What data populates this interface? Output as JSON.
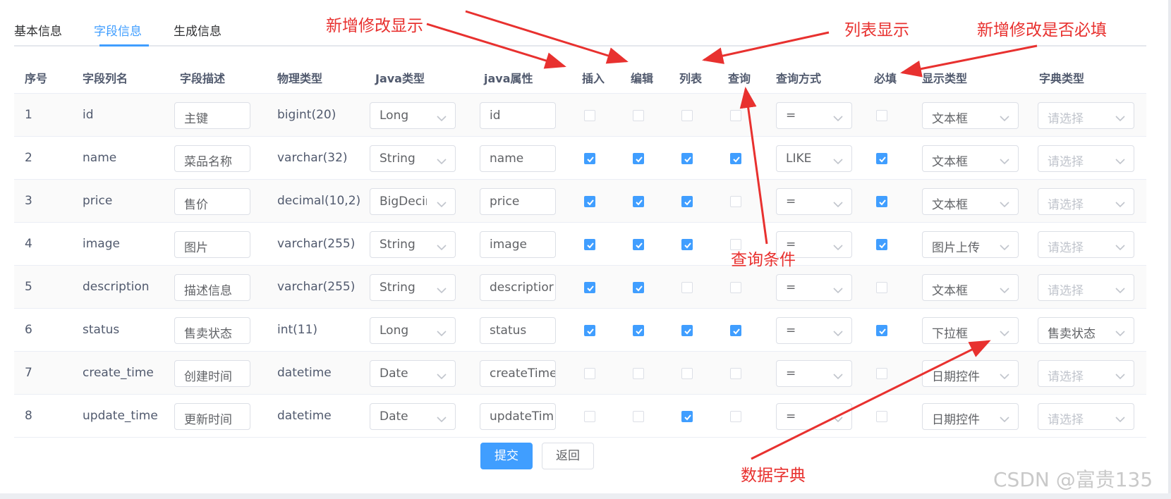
{
  "tabs": [
    {
      "label": "基本信息"
    },
    {
      "label": "字段信息"
    },
    {
      "label": "生成信息"
    }
  ],
  "table": {
    "headers": [
      "序号",
      "字段列名",
      "字段描述",
      "物理类型",
      "Java类型",
      "java属性",
      "插入",
      "编辑",
      "列表",
      "查询",
      "查询方式",
      "必填",
      "显示类型",
      "字典类型"
    ],
    "rows": [
      {
        "index": "1",
        "column": "id",
        "desc": "主键",
        "physical": "bigint(20)",
        "javaType": "Long",
        "javaField": "id",
        "insert": false,
        "edit": false,
        "list": false,
        "query": false,
        "queryType": "=",
        "required": false,
        "htmlType": "文本框",
        "dictType": "请选择",
        "dictPlaceholder": true
      },
      {
        "index": "2",
        "column": "name",
        "desc": "菜品名称",
        "physical": "varchar(32)",
        "javaType": "String",
        "javaField": "name",
        "insert": true,
        "edit": true,
        "list": true,
        "query": true,
        "queryType": "LIKE",
        "required": true,
        "htmlType": "文本框",
        "dictType": "请选择",
        "dictPlaceholder": true
      },
      {
        "index": "3",
        "column": "price",
        "desc": "售价",
        "physical": "decimal(10,2)",
        "javaType": "BigDecin",
        "javaField": "price",
        "insert": true,
        "edit": true,
        "list": true,
        "query": false,
        "queryType": "=",
        "required": true,
        "htmlType": "文本框",
        "dictType": "请选择",
        "dictPlaceholder": true
      },
      {
        "index": "4",
        "column": "image",
        "desc": "图片",
        "physical": "varchar(255)",
        "javaType": "String",
        "javaField": "image",
        "insert": true,
        "edit": true,
        "list": true,
        "query": false,
        "queryType": "=",
        "required": true,
        "htmlType": "图片上传",
        "dictType": "请选择",
        "dictPlaceholder": true
      },
      {
        "index": "5",
        "column": "description",
        "desc": "描述信息",
        "physical": "varchar(255)",
        "javaType": "String",
        "javaField": "descriptior",
        "insert": true,
        "edit": true,
        "list": false,
        "query": false,
        "queryType": "=",
        "required": false,
        "htmlType": "文本框",
        "dictType": "请选择",
        "dictPlaceholder": true
      },
      {
        "index": "6",
        "column": "status",
        "desc": "售卖状态",
        "physical": "int(11)",
        "javaType": "Long",
        "javaField": "status",
        "insert": true,
        "edit": true,
        "list": true,
        "query": true,
        "queryType": "=",
        "required": true,
        "htmlType": "下拉框",
        "dictType": "售卖状态",
        "dictPlaceholder": false
      },
      {
        "index": "7",
        "column": "create_time",
        "desc": "创建时间",
        "physical": "datetime",
        "javaType": "Date",
        "javaField": "createTime",
        "insert": false,
        "edit": false,
        "list": false,
        "query": false,
        "queryType": "=",
        "required": false,
        "htmlType": "日期控件",
        "dictType": "请选择",
        "dictPlaceholder": true
      },
      {
        "index": "8",
        "column": "update_time",
        "desc": "更新时间",
        "physical": "datetime",
        "javaType": "Date",
        "javaField": "updateTim",
        "insert": false,
        "edit": false,
        "list": true,
        "query": false,
        "queryType": "=",
        "required": false,
        "htmlType": "日期控件",
        "dictType": "请选择",
        "dictPlaceholder": true
      }
    ]
  },
  "buttons": {
    "submit": "提交",
    "back": "返回"
  },
  "annotations": {
    "insert_edit": "新增修改显示",
    "list": "列表显示",
    "required": "新增修改是否必填",
    "query": "查询条件",
    "dict": "数据字典"
  },
  "watermark": "CSDN @富贵135",
  "colors": {
    "primary": "#409eff",
    "annotation": "#e8312f",
    "header_text": "#515a6e",
    "border": "#dcdfe6"
  },
  "icons": {
    "select_arrow": "chevron-down-icon",
    "checkbox_checked": "check-icon"
  }
}
